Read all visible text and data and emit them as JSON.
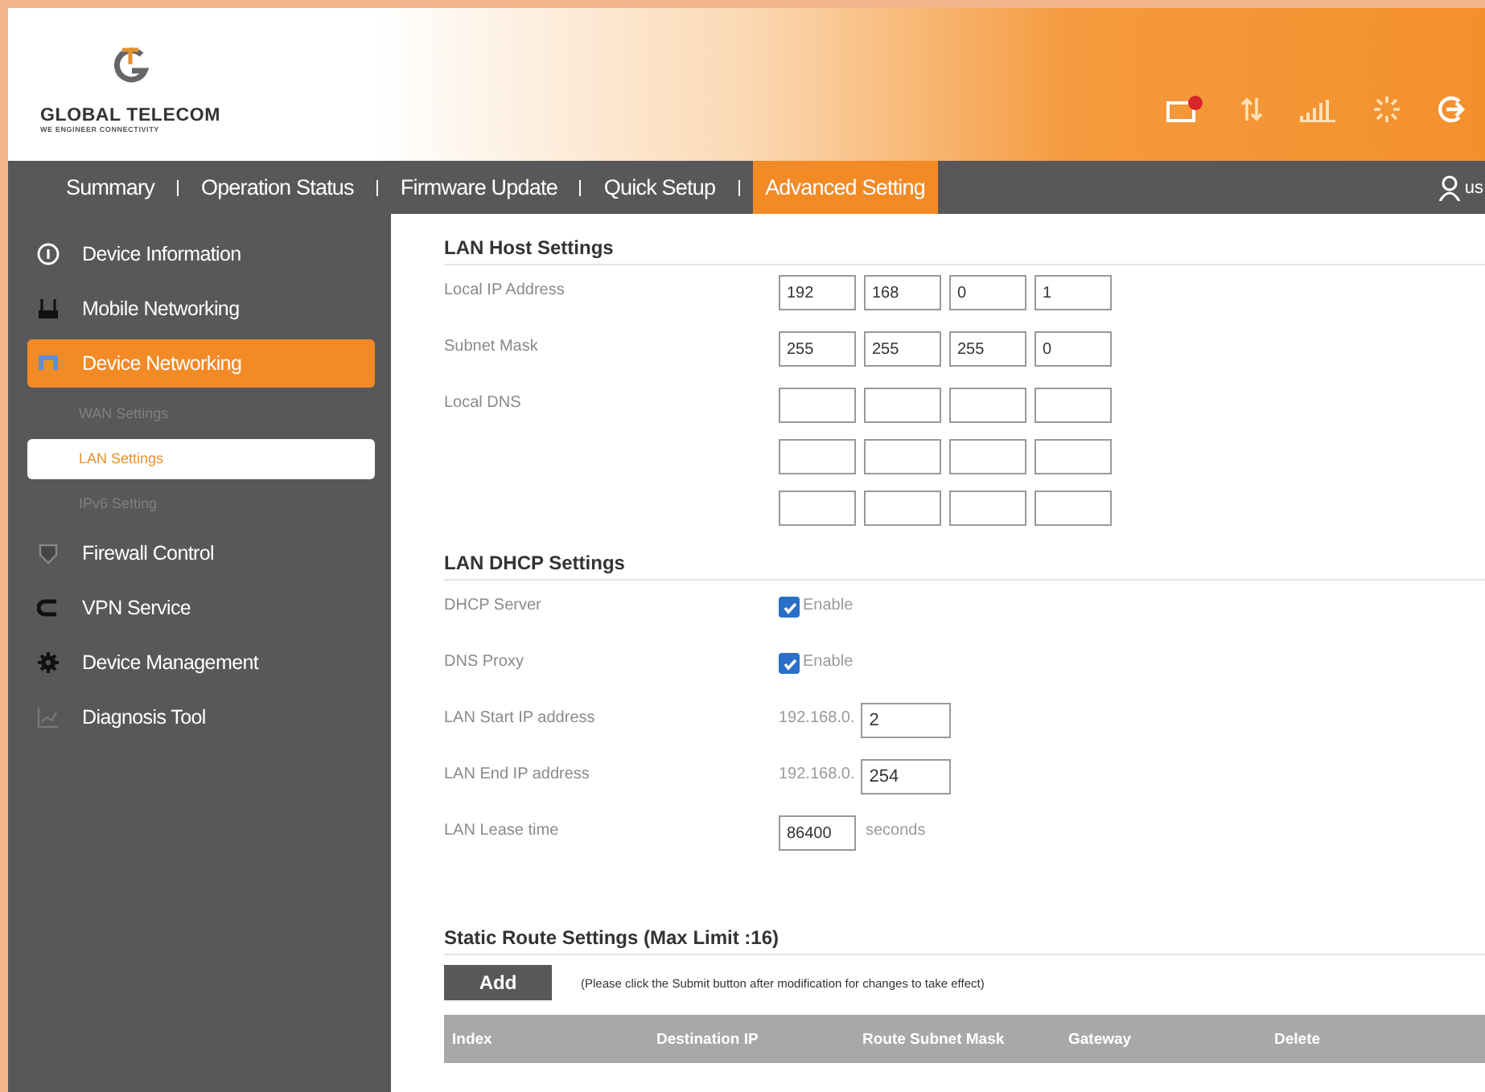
{
  "header": {
    "brand": "GLOBAL TELECOM",
    "tagline": "WE ENGINEER CONNECTIVITY"
  },
  "nav": {
    "tabs": [
      {
        "label": "Summary",
        "selected": false
      },
      {
        "label": "Operation Status",
        "selected": false
      },
      {
        "label": "Firmware Update",
        "selected": false
      },
      {
        "label": "Quick Setup",
        "selected": false
      },
      {
        "label": "Advanced Setting",
        "selected": true
      }
    ],
    "user": "us"
  },
  "sidebar": {
    "items": [
      {
        "label": "Device Information",
        "selected": false
      },
      {
        "label": "Mobile Networking",
        "selected": false
      },
      {
        "label": "Device Networking",
        "selected": true,
        "children": [
          {
            "label": "WAN Settings",
            "selected": false
          },
          {
            "label": "LAN Settings",
            "selected": true
          },
          {
            "label": "IPv6 Setting",
            "selected": false
          }
        ]
      },
      {
        "label": "Firewall Control",
        "selected": false
      },
      {
        "label": "VPN Service",
        "selected": false
      },
      {
        "label": "Device Management",
        "selected": false
      },
      {
        "label": "Diagnosis Tool",
        "selected": false
      }
    ]
  },
  "lan_host": {
    "title": "LAN Host Settings",
    "rows": [
      {
        "kind": "ip",
        "label": "Local IP Address",
        "octets": [
          "192",
          "168",
          "0",
          "1"
        ]
      },
      {
        "kind": "ip",
        "label": "Subnet Mask",
        "octets": [
          "255",
          "255",
          "255",
          "0"
        ]
      },
      {
        "kind": "dns",
        "label": "Local DNS"
      }
    ]
  },
  "lan_dhcp": {
    "title": "LAN DHCP Settings",
    "rows": [
      {
        "kind": "checkbox",
        "label": "DHCP Server",
        "checked": true,
        "text": "Enable"
      },
      {
        "kind": "checkbox",
        "label": "DNS Proxy",
        "checked": true,
        "text": "Enable"
      },
      {
        "kind": "ip",
        "label": "LAN Start IP address",
        "prefix": "192.168.0.",
        "value": "2"
      },
      {
        "kind": "ip",
        "label": "LAN End IP address",
        "prefix": "192.168.0.",
        "value": "254"
      },
      {
        "kind": "unit",
        "label": "LAN Lease time",
        "value": "86400",
        "unit": "seconds"
      }
    ]
  },
  "static_route": {
    "title": "Static Route Settings (Max Limit :16)",
    "add_button": "Add",
    "note": "(Please click the Submit button after modification for changes to take effect)",
    "columns": [
      "Index",
      "Destination IP",
      "Route Subnet Mask",
      "Gateway",
      "Delete"
    ]
  }
}
